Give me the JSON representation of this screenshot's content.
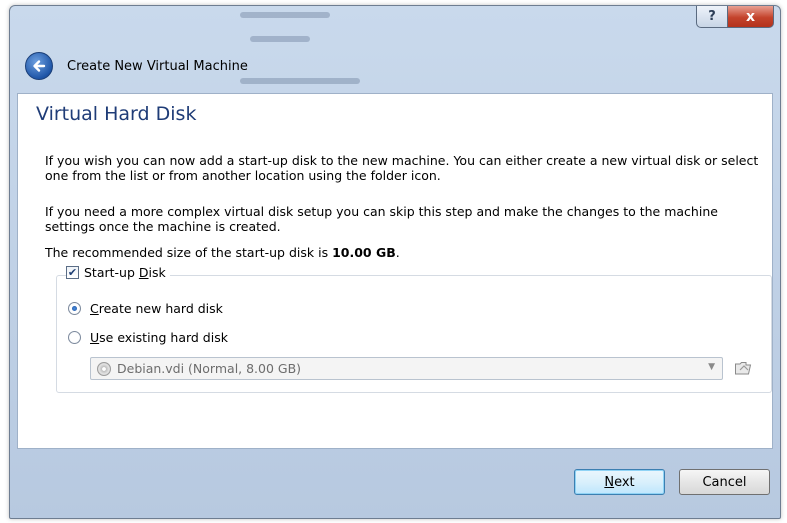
{
  "window": {
    "title": "Create New Virtual Machine",
    "help_glyph": "?",
    "close_glyph": "x"
  },
  "page": {
    "heading": "Virtual Hard Disk",
    "para1": "If you wish you can now add a start-up disk to the new machine. You can either create a new virtual disk or select one from the list or from another location using the folder icon.",
    "para2": "If you need a more complex virtual disk setup you can skip this step and make the changes to the machine settings once the machine is created.",
    "recommended_prefix": "The recommended size of the start-up disk is ",
    "recommended_size": "10.00 GB",
    "recommended_suffix": "."
  },
  "startup_disk": {
    "label_prefix": "Start-up ",
    "label_mnemonic": "D",
    "label_suffix": "isk",
    "checked": true
  },
  "options": {
    "create_mnemonic": "C",
    "create_rest": "reate new hard disk",
    "create_selected": true,
    "existing_mnemonic": "U",
    "existing_rest": "se existing hard disk",
    "existing_selected": false
  },
  "disk_combo": {
    "value": "Debian.vdi (Normal, 8.00 GB)",
    "enabled": false
  },
  "buttons": {
    "next_mnemonic": "N",
    "next_rest": "ext",
    "cancel": "Cancel"
  },
  "colors": {
    "heading": "#1f3c77",
    "frame": "#b7c9e0",
    "close": "#c4432c"
  }
}
